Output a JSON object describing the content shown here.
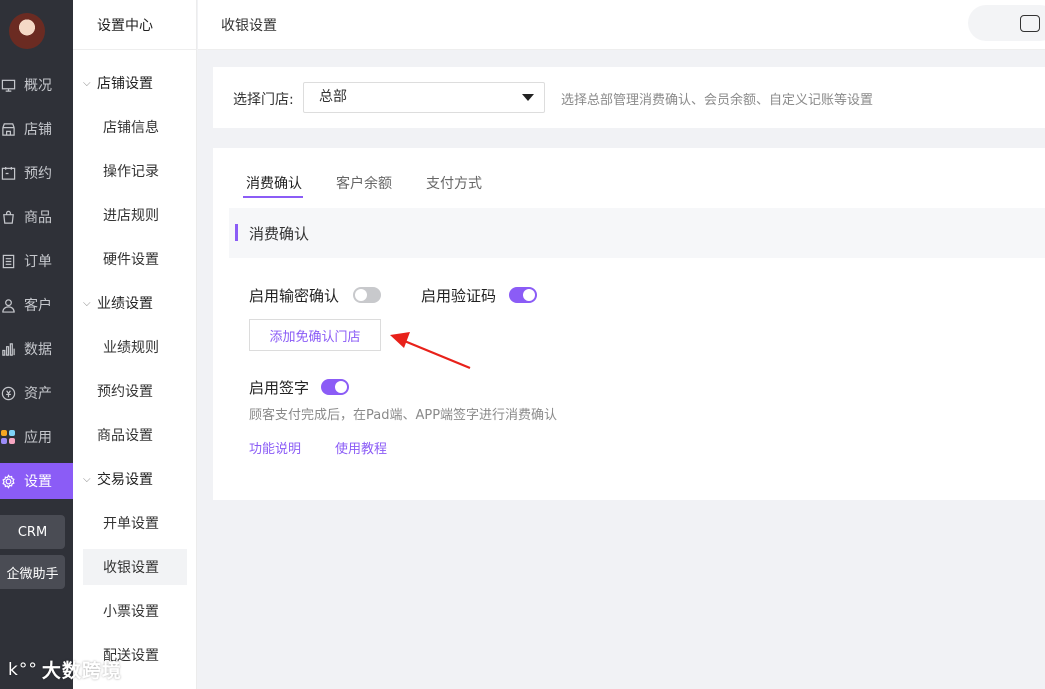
{
  "nav": {
    "items": [
      {
        "label": "概况",
        "icon": "monitor-icon"
      },
      {
        "label": "店铺",
        "icon": "store-icon"
      },
      {
        "label": "预约",
        "icon": "calendar-icon"
      },
      {
        "label": "商品",
        "icon": "bag-icon"
      },
      {
        "label": "订单",
        "icon": "list-icon"
      },
      {
        "label": "客户",
        "icon": "user-icon"
      },
      {
        "label": "数据",
        "icon": "bar-chart-icon"
      },
      {
        "label": "资产",
        "icon": "coin-icon"
      },
      {
        "label": "应用",
        "icon": "apps-icon"
      },
      {
        "label": "设置",
        "icon": "gear-icon"
      }
    ],
    "crm_label": "CRM",
    "assistant_label": "企微助手"
  },
  "subnav": {
    "header": "设置中心",
    "items": [
      {
        "label": "店铺设置"
      },
      {
        "label": "店铺信息"
      },
      {
        "label": "操作记录"
      },
      {
        "label": "进店规则"
      },
      {
        "label": "硬件设置"
      },
      {
        "label": "业绩设置"
      },
      {
        "label": "业绩规则"
      },
      {
        "label": "预约设置"
      },
      {
        "label": "商品设置"
      },
      {
        "label": "交易设置"
      },
      {
        "label": "开单设置"
      },
      {
        "label": "收银设置"
      },
      {
        "label": "小票设置"
      },
      {
        "label": "配送设置"
      }
    ]
  },
  "topbar": {
    "title": "收银设置"
  },
  "store_select": {
    "label": "选择门店:",
    "value": "总部",
    "hint": "选择总部管理消费确认、会员余额、自定义记账等设置"
  },
  "tabs": [
    "消费确认",
    "客户余额",
    "支付方式"
  ],
  "section_title": "消费确认",
  "options": {
    "password_confirm": {
      "label": "启用输密确认",
      "enabled": false
    },
    "verify_code": {
      "label": "启用验证码",
      "enabled": true
    },
    "add_exempt_store": "添加免确认门店",
    "signature": {
      "label": "启用签字",
      "enabled": true
    },
    "signature_desc": "顾客支付完成后，在Pad端、APP端签字进行消费确认"
  },
  "links": {
    "feature_desc": "功能说明",
    "tutorial": "使用教程"
  },
  "watermark": {
    "logo": "k°°",
    "text": "大数跨境"
  },
  "colors": {
    "accent": "#8b5cf6",
    "nav_bg": "#2f3138"
  }
}
